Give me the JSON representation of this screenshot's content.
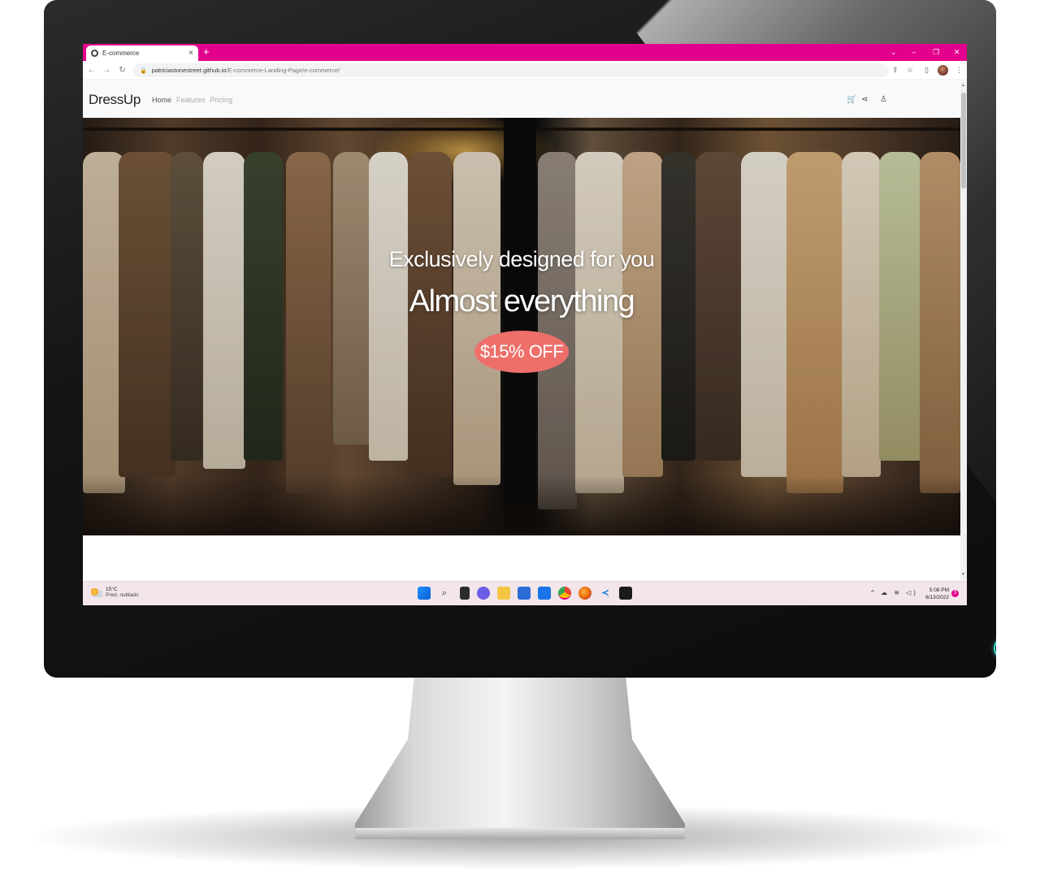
{
  "browser": {
    "tab_title": "E-commerce",
    "tab_close": "×",
    "new_tab": "+",
    "window_controls": [
      "⌄",
      "–",
      "❐",
      "✕"
    ],
    "nav_back": "←",
    "nav_forward": "→",
    "nav_reload": "↻",
    "url_host": "patriciastonestreet.github.io",
    "url_path": "/E-commerce-Landing-Page/e-commerce/",
    "toolbar_icons": [
      "share-icon",
      "star-icon",
      "sidepanel-icon",
      "profile-avatar",
      "menu-icon"
    ],
    "accent_color": "#e3008c"
  },
  "site": {
    "brand": "DressUp",
    "nav": [
      {
        "label": "Home",
        "active": true
      },
      {
        "label": "Features",
        "active": false
      },
      {
        "label": "Pricing",
        "active": false
      }
    ],
    "icons": [
      "cart-icon",
      "share-icon",
      "user-icon"
    ],
    "hero": {
      "tagline": "Exclusively designed for you",
      "headline": "Almost everything",
      "badge": "$15% OFF",
      "badge_color": "#ee6f6a"
    }
  },
  "taskbar": {
    "weather_temp": "15°C",
    "weather_desc": "Pred. nublado",
    "apps": [
      "start-icon",
      "search-icon",
      "task-view-icon",
      "chat-icon",
      "file-explorer-icon",
      "store-icon",
      "mail-icon",
      "chrome-icon",
      "firefox-icon",
      "vscode-icon",
      "terminal-icon"
    ],
    "tray": "^ ☁ ≋ ◁)",
    "time": "5:08 PM",
    "date": "6/13/2022",
    "notifications": "3"
  }
}
